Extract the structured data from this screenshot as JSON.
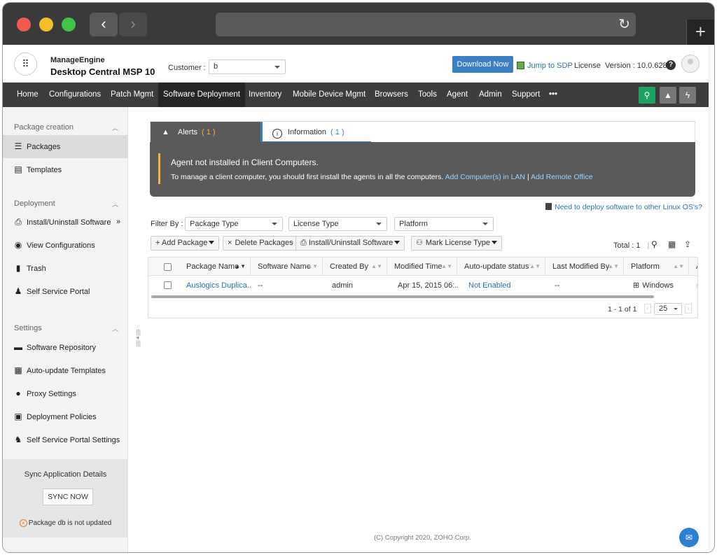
{
  "chrome": {
    "back": "‹",
    "forward": "›",
    "reload": "↻",
    "new_tab": "+"
  },
  "header": {
    "brand_top": "ManageEngine",
    "brand_name": "Desktop Central MSP 10",
    "customer_label": "Customer :",
    "customer_value": "b",
    "download_label": "Download Now",
    "sdp_label": "Jump to SDP",
    "license_label": "License",
    "version_label": "Version : 10.0.628",
    "help": "?"
  },
  "nav": {
    "items": [
      "Home",
      "Configurations",
      "Patch Mgmt",
      "Software Deployment",
      "Inventory",
      "Mobile Device Mgmt",
      "Browsers",
      "Tools",
      "Agent",
      "Admin",
      "Support",
      "•••"
    ]
  },
  "sidebar": {
    "sections": [
      "Package creation",
      "Deployment",
      "Settings"
    ],
    "items": [
      "Packages",
      "Templates",
      "Install/Uninstall Software",
      "View Configurations",
      "Trash",
      "Self Service Portal",
      "Software Repository",
      "Auto-update Templates",
      "Proxy Settings",
      "Deployment Policies",
      "Self Service Portal Settings"
    ],
    "expand": "»",
    "sync_title": "Sync Application Details",
    "sync_button": "SYNC NOW",
    "sync_error": "Package db is not updated"
  },
  "alerts": {
    "tab_alerts": "Alerts",
    "tab_alerts_count": "( 1 )",
    "tab_info": "Information",
    "tab_info_count": "( 1 )",
    "title": "Agent not installed in Client Computers.",
    "message": "To manage a client computer, you should first install the agents in all the computers.",
    "link1": "Add Computer(s) in LAN",
    "sep": "|",
    "link2": "Add Remote Office"
  },
  "linux_link": "Need to deploy software to other Linux OS's?",
  "filters": {
    "label": "Filter By :",
    "package_type": "Package Type",
    "license_type": "License Type",
    "platform": "Platform"
  },
  "actions": {
    "add_package": "+ Add Package",
    "delete_packages": "Delete Packages",
    "install_uninstall": "Install/Uninstall Software",
    "mark_license": "Mark License Type",
    "total": "Total : 1",
    "sep": "|"
  },
  "table": {
    "headers": [
      "Package Name",
      "Software Name",
      "Created By",
      "Modified Time",
      "Auto-update status",
      "Last Modified By",
      "Platform",
      "A"
    ],
    "rows": [
      [
        "Auslogics Duplica...",
        "--",
        "admin",
        "Apr 15, 2015 06:...",
        "Not Enabled",
        "--",
        "Windows"
      ]
    ],
    "pager_info": "1 - 1 of 1",
    "page_size": "25"
  },
  "footer": {
    "copyright": "(C) Copyright 2020, ZOHO Corp."
  },
  "colors": {
    "accent": "#3b7fc4",
    "nav_bg": "#3d3d3d",
    "alert_bg": "#5a5a5a",
    "warn": "#f5b342",
    "search_green": "#1ea362"
  }
}
